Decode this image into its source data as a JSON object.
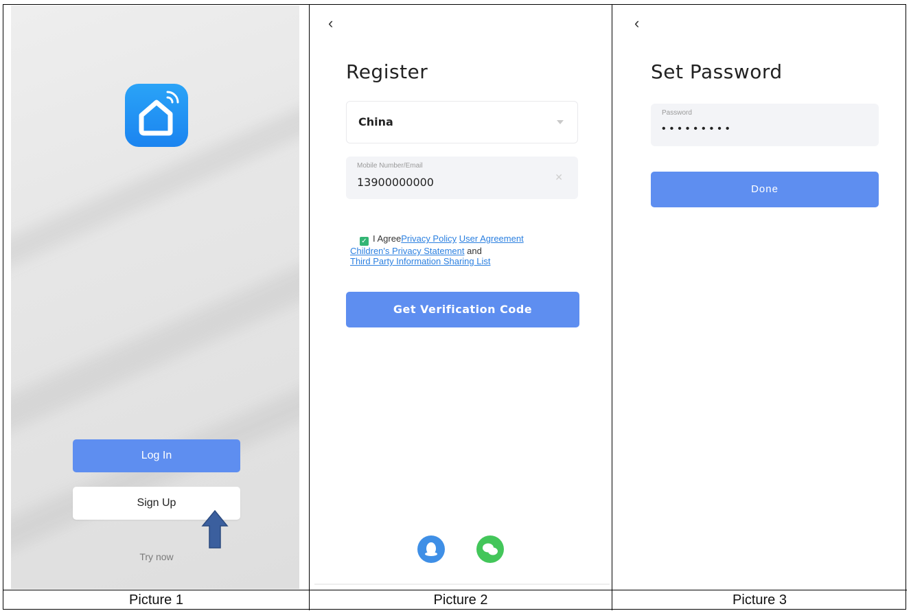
{
  "captions": [
    "Picture 1",
    "Picture 2",
    "Picture 3"
  ],
  "screen1": {
    "login_label": "Log In",
    "signup_label": "Sign Up",
    "try_now_label": "Try now"
  },
  "screen2": {
    "title": "Register",
    "country_value": "China",
    "mobile_label": "Mobile Number/Email",
    "mobile_value": "13900000000",
    "agree_prefix": "I Agree",
    "privacy_policy": "Privacy Policy",
    "user_agreement": "User Agreement",
    "childrens_privacy": "Children's Privacy Statement",
    "and_text": "and",
    "third_party": "Third Party Information Sharing List",
    "verify_button": "Get Verification Code",
    "back_glyph": "‹"
  },
  "screen3": {
    "title": "Set Password",
    "password_label": "Password",
    "password_mask": "•••••••••",
    "done_button": "Done",
    "back_glyph": "‹"
  },
  "colors": {
    "primary_button": "#5e8ef0",
    "app_icon": "#1b84f0",
    "link": "#2a7fe0",
    "checkbox": "#33b574",
    "qq": "#3f8fe6",
    "wechat": "#43c65a",
    "arrow": "#3b5f9e"
  },
  "icons": [
    "smart-home-app-icon",
    "up-arrow-icon",
    "back-chevron-icon",
    "dropdown-caret-icon",
    "clear-icon",
    "checkbox-checked-icon",
    "qq-icon",
    "wechat-icon"
  ]
}
